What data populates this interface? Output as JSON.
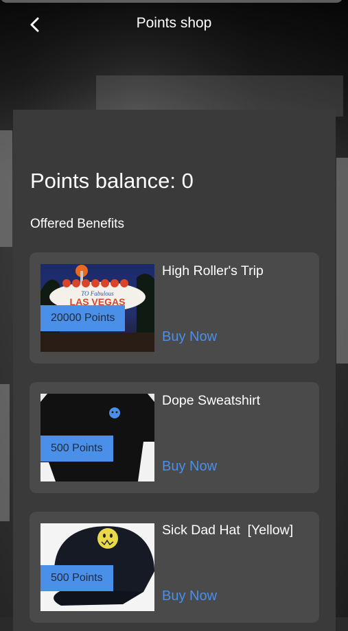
{
  "header": {
    "title": "Points shop",
    "back_icon": "chevron-left-icon"
  },
  "balance": {
    "label": "Points balance: 0"
  },
  "section": {
    "title": "Offered Benefits"
  },
  "benefits": [
    {
      "title": "High Roller's Trip",
      "points": "20000 Points",
      "action": "Buy Now",
      "image": "las-vegas-sign"
    },
    {
      "title": "Dope Sweatshirt",
      "points": "500 Points",
      "action": "Buy Now",
      "image": "black-sweatshirt"
    },
    {
      "title": "Sick Dad Hat  [Yellow]",
      "points": "500 Points",
      "action": "Buy Now",
      "image": "black-cap-yellow-smiley"
    }
  ],
  "colors": {
    "accent": "#4a8fe8",
    "card": "#4a4a4a",
    "panel": "#3a3a3a"
  },
  "thumb_text": {
    "vegas_line1": "TO Fabulous",
    "vegas_line2": "LAS VEGAS"
  }
}
